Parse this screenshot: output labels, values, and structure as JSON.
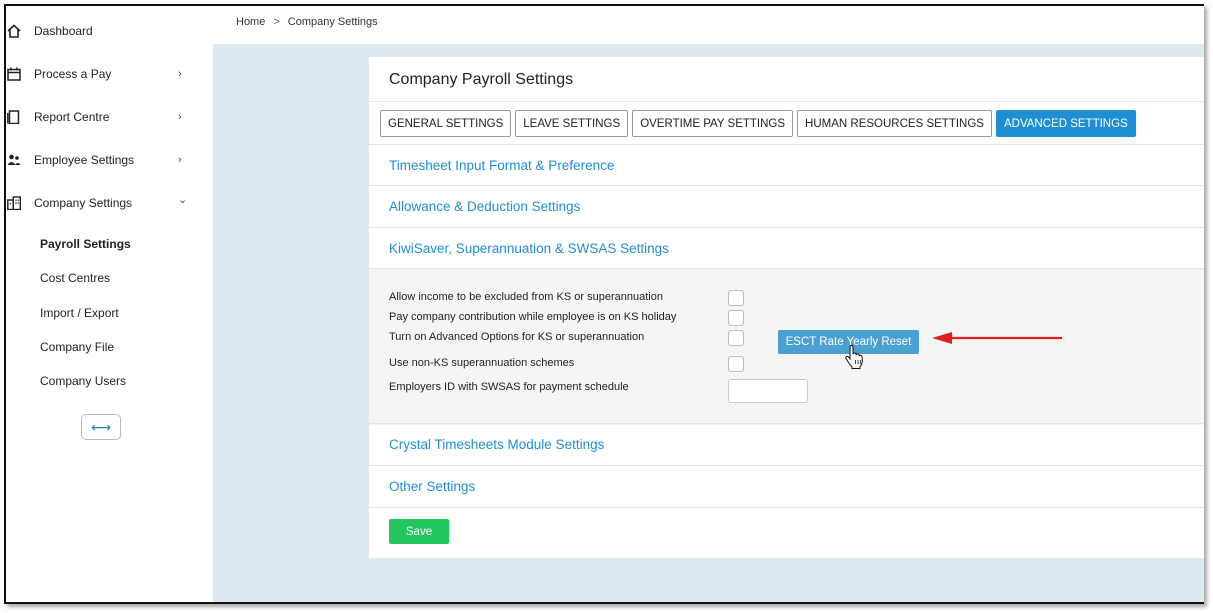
{
  "sidebar": {
    "items": [
      {
        "label": "Dashboard",
        "icon": "home-icon"
      },
      {
        "label": "Process a Pay",
        "icon": "calendar-icon",
        "chevron": "›"
      },
      {
        "label": "Report Centre",
        "icon": "document-icon",
        "chevron": "›"
      },
      {
        "label": "Employee Settings",
        "icon": "users-icon",
        "chevron": "›"
      },
      {
        "label": "Company Settings",
        "icon": "building-icon",
        "chevron": "⌄"
      }
    ],
    "sub_items": [
      "Payroll Settings",
      "Cost Centres",
      "Import / Export",
      "Company File",
      "Company Users"
    ],
    "toggle_icon": "⟷"
  },
  "breadcrumb": {
    "home": "Home",
    "sep": ">",
    "current": "Company Settings"
  },
  "card": {
    "title": "Company Payroll Settings",
    "tabs": [
      "GENERAL SETTINGS",
      "LEAVE SETTINGS",
      "OVERTIME PAY SETTINGS",
      "HUMAN RESOURCES SETTINGS",
      "ADVANCED SETTINGS"
    ],
    "sections": {
      "timesheet": "Timesheet Input Format & Preference",
      "allowance": "Allowance & Deduction Settings",
      "kiwisaver": "KiwiSaver, Superannuation & SWSAS Settings",
      "crystal": "Crystal Timesheets Module Settings",
      "other": "Other Settings"
    },
    "options": [
      "Allow income to be excluded from KS or superannuation",
      "Pay company contribution while employee is on KS holiday",
      "Turn on Advanced Options for KS or superannuation",
      "Use non-KS superannuation schemes",
      "Employers ID with SWSAS for payment schedule"
    ],
    "esct_button": "ESCT Rate Yearly Reset",
    "save_button": "Save"
  },
  "colors": {
    "accent": "#1f8fd3",
    "save": "#22c55e",
    "esct": "#4aa1d1",
    "arrow": "#e02020",
    "background": "#dde9f1"
  }
}
